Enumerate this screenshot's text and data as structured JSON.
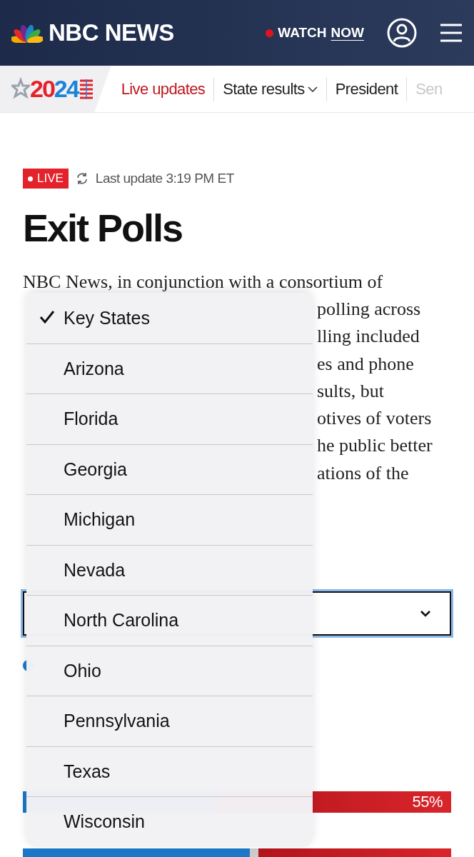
{
  "header": {
    "brand": "NBC NEWS",
    "watch": {
      "prefix": "WATCH",
      "link": "NOW"
    }
  },
  "nav": {
    "logo_year": "2024",
    "items": [
      {
        "label": "Live updates",
        "selected": true,
        "has_menu": false
      },
      {
        "label": "State results",
        "selected": false,
        "has_menu": true
      },
      {
        "label": "President",
        "selected": false,
        "has_menu": false
      },
      {
        "label": "Sen",
        "selected": false,
        "has_menu": false
      }
    ]
  },
  "article": {
    "live_badge": "LIVE",
    "last_update": "Last update 3:19 PM ET",
    "title": "Exit Polls",
    "intro_first_line": "NBC News, in conjunction with a consortium of",
    "intro_visible_fragments": [
      "polling across",
      "lling included",
      "es and phone",
      "sults, but",
      "otives of voters",
      "he public better",
      "ations of the"
    ]
  },
  "bars": [
    {
      "reading": "55%"
    }
  ],
  "state_menu": [
    {
      "label": "Key States",
      "selected": true
    },
    {
      "label": "Arizona",
      "selected": false
    },
    {
      "label": "Florida",
      "selected": false
    },
    {
      "label": "Georgia",
      "selected": false
    },
    {
      "label": "Michigan",
      "selected": false
    },
    {
      "label": "Nevada",
      "selected": false
    },
    {
      "label": "North Carolina",
      "selected": false
    },
    {
      "label": "Ohio",
      "selected": false
    },
    {
      "label": "Pennsylvania",
      "selected": false
    },
    {
      "label": "Texas",
      "selected": false
    },
    {
      "label": "Wisconsin",
      "selected": false
    }
  ]
}
